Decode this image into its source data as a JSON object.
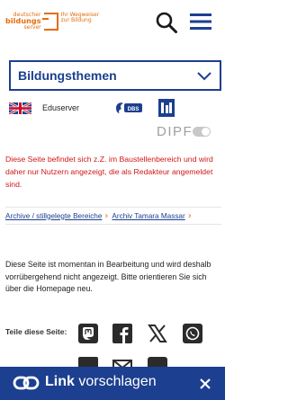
{
  "header": {
    "logo_line1": "deutscher",
    "logo_line2": "bildungs",
    "logo_line3": "server",
    "logo_tagline1": "Ihr Wegweiser",
    "logo_tagline2": "zur Bildung",
    "search_icon": "search-icon",
    "menu_icon": "hamburger-menu-icon"
  },
  "theme_select": {
    "label": "Bildungsthemen"
  },
  "partners": {
    "eduserver": "Eduserver",
    "dipf": "DIPF"
  },
  "notice": "Diese Seite befindet sich z.Z. im Baustellenbereich und wird daher nur Nutzern angezeigt, die als Redakteur angemeldet sind.",
  "breadcrumb": [
    {
      "label": "Archive / stillgelegte Bereiche"
    },
    {
      "label": "Archiv Tamara Massar"
    }
  ],
  "info": "Diese Seite ist momentan in Bearbeitung und wird deshalb vorrübergehend nicht angezeigt. Bitte orientieren Sie sich über die Homepage neu.",
  "share": {
    "label": "Teile diese Seite:",
    "icons": [
      "mastodon-icon",
      "facebook-icon",
      "x-icon",
      "whatsapp-icon",
      "linkedin-icon",
      "email-icon",
      "link-icon"
    ]
  },
  "banner": {
    "brand": "Link",
    "text": "vorschlagen"
  },
  "colors": {
    "brand_blue": "#1c3f8f",
    "brand_orange": "#e46c0a",
    "warning_red": "#d01818"
  }
}
